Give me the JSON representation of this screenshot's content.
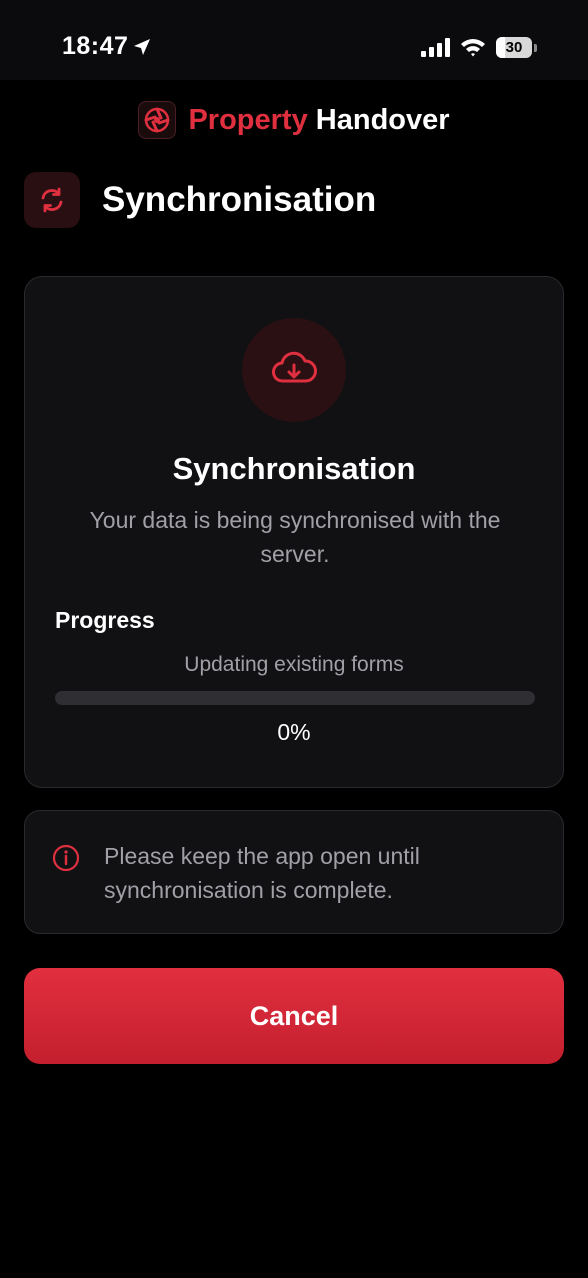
{
  "status_bar": {
    "time": "18:47",
    "battery": "30"
  },
  "app": {
    "title_accent": "Property",
    "title_rest": "Handover"
  },
  "page": {
    "title": "Synchronisation"
  },
  "card": {
    "title": "Synchronisation",
    "description": "Your data is being synchronised with the server.",
    "progress_label": "Progress",
    "progress_status": "Updating existing forms",
    "progress_value": 0,
    "progress_percent": "0%"
  },
  "notice": {
    "text": "Please keep the app open until synchronisation is complete."
  },
  "actions": {
    "cancel_label": "Cancel"
  },
  "colors": {
    "accent": "#e03040",
    "background": "#000000",
    "card": "#111114"
  },
  "icons": [
    "location-arrow-icon",
    "signal-icon",
    "wifi-icon",
    "battery-icon",
    "app-logo-icon",
    "sync-icon",
    "cloud-download-icon",
    "info-icon"
  ]
}
